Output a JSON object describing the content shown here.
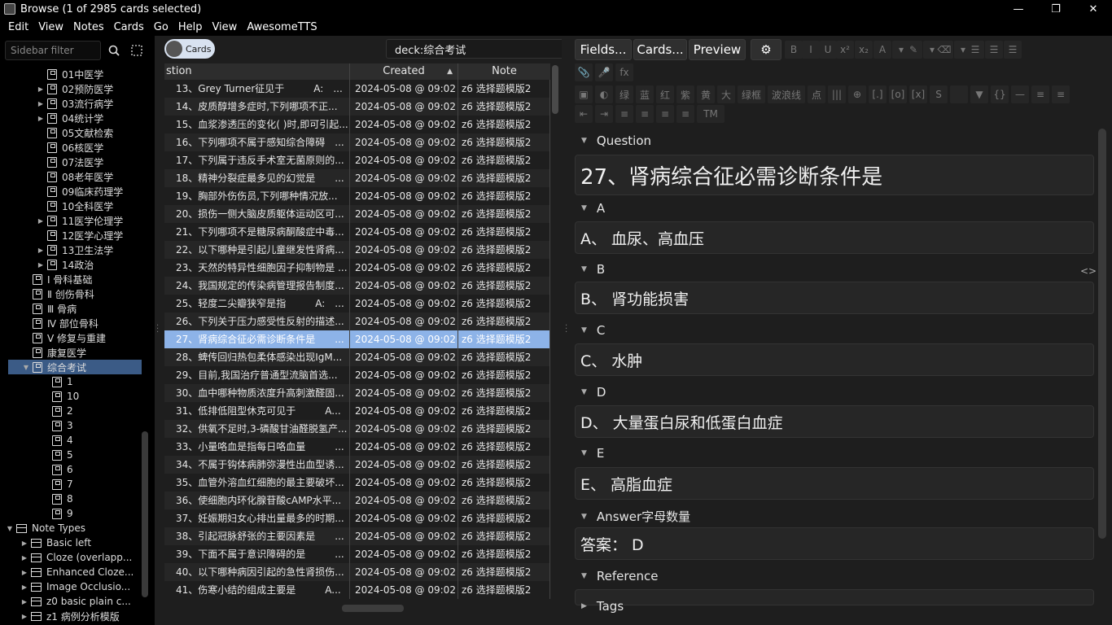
{
  "window": {
    "title": "Browse (1 of 2985 cards selected)",
    "minimize": "—",
    "restore": "❐",
    "close": "✕"
  },
  "menu": [
    "Edit",
    "View",
    "Notes",
    "Cards",
    "Go",
    "Help",
    "View",
    "AwesomeTTS"
  ],
  "sidebar": {
    "filter_placeholder": "Sidebar filter",
    "items": [
      {
        "label": "01中医学",
        "level": 3,
        "arrow": ""
      },
      {
        "label": "02预防医学",
        "level": 3,
        "arrow": "▶"
      },
      {
        "label": "03流行病学",
        "level": 3,
        "arrow": "▶"
      },
      {
        "label": "04统计学",
        "level": 3,
        "arrow": "▶"
      },
      {
        "label": "05文献检索",
        "level": 3,
        "arrow": ""
      },
      {
        "label": "06核医学",
        "level": 3,
        "arrow": ""
      },
      {
        "label": "07法医学",
        "level": 3,
        "arrow": ""
      },
      {
        "label": "08老年医学",
        "level": 3,
        "arrow": ""
      },
      {
        "label": "09临床药理学",
        "level": 3,
        "arrow": ""
      },
      {
        "label": "10全科医学",
        "level": 3,
        "arrow": ""
      },
      {
        "label": "11医学伦理学",
        "level": 3,
        "arrow": "▶"
      },
      {
        "label": "12医学心理学",
        "level": 3,
        "arrow": ""
      },
      {
        "label": "13卫生法学",
        "level": 3,
        "arrow": "▶"
      },
      {
        "label": "14政治",
        "level": 3,
        "arrow": "▶"
      },
      {
        "label": "Ⅰ 骨科基础",
        "level": 2,
        "arrow": ""
      },
      {
        "label": "Ⅱ 创伤骨科",
        "level": 2,
        "arrow": ""
      },
      {
        "label": "Ⅲ 骨病",
        "level": 2,
        "arrow": ""
      },
      {
        "label": "Ⅳ 部位骨科",
        "level": 2,
        "arrow": ""
      },
      {
        "label": "Ⅴ 修复与重建",
        "level": 2,
        "arrow": ""
      },
      {
        "label": "康复医学",
        "level": 2,
        "arrow": ""
      },
      {
        "label": "综合考试",
        "level": 2,
        "arrow": "▼",
        "selected": true
      },
      {
        "label": "1",
        "level": 3,
        "arrow": ""
      },
      {
        "label": "10",
        "level": 3,
        "arrow": ""
      },
      {
        "label": "2",
        "level": 3,
        "arrow": ""
      },
      {
        "label": "3",
        "level": 3,
        "arrow": ""
      },
      {
        "label": "4",
        "level": 3,
        "arrow": ""
      },
      {
        "label": "5",
        "level": 3,
        "arrow": ""
      },
      {
        "label": "6",
        "level": 3,
        "arrow": ""
      },
      {
        "label": "7",
        "level": 3,
        "arrow": ""
      },
      {
        "label": "8",
        "level": 3,
        "arrow": ""
      },
      {
        "label": "9",
        "level": 3,
        "arrow": ""
      },
      {
        "label": "Note Types",
        "level": 0,
        "arrow": "▼",
        "type": "nt"
      },
      {
        "label": "Basic left",
        "level": 1,
        "arrow": "▶",
        "type": "nt"
      },
      {
        "label": "Cloze (overlapp...",
        "level": 1,
        "arrow": "▶",
        "type": "nt"
      },
      {
        "label": "Enhanced Cloze...",
        "level": 1,
        "arrow": "▶",
        "type": "nt"
      },
      {
        "label": "Image Occlusio...",
        "level": 1,
        "arrow": "▶",
        "type": "nt"
      },
      {
        "label": "z0 basic plain c...",
        "level": 1,
        "arrow": "▶",
        "type": "nt"
      },
      {
        "label": "z1 病例分析模版",
        "level": 1,
        "arrow": "▶",
        "type": "nt"
      }
    ]
  },
  "cards": {
    "toggle_label": "Cards",
    "search_value": "deck:综合考试",
    "columns": [
      "stion",
      "Created",
      "Note"
    ],
    "sort_indicator": "▲",
    "rows": [
      {
        "q": "13、Grey Turner征见于　　　A:　...",
        "created": "2024-05-08 @ 09:02",
        "note": "z6 选择题模版2"
      },
      {
        "q": "14、皮质醇增多症时,下列哪项不正...",
        "created": "2024-05-08 @ 09:02",
        "note": "z6 选择题模版2"
      },
      {
        "q": "15、血浆渗透压的变化( )时,即可引起...",
        "created": "2024-05-08 @ 09:02",
        "note": "z6 选择题模版2"
      },
      {
        "q": "16、下列哪项不属于感知综合障碍　...",
        "created": "2024-05-08 @ 09:02",
        "note": "z6 选择题模版2"
      },
      {
        "q": "17、下列属于违反手术室无菌原则的...",
        "created": "2024-05-08 @ 09:02",
        "note": "z6 选择题模版2"
      },
      {
        "q": "18、精神分裂症最多见的幻觉是　　...",
        "created": "2024-05-08 @ 09:02",
        "note": "z6 选择题模版2"
      },
      {
        "q": "19、胸部外伤伤员,下列哪种情况放...",
        "created": "2024-05-08 @ 09:02",
        "note": "z6 选择题模版2"
      },
      {
        "q": "20、损伤一侧大脑皮质躯体运动区可...",
        "created": "2024-05-08 @ 09:02",
        "note": "z6 选择题模版2"
      },
      {
        "q": "21、下列哪项不是糖尿病酮酸症中毒...",
        "created": "2024-05-08 @ 09:02",
        "note": "z6 选择题模版2"
      },
      {
        "q": "22、以下哪种是引起儿童继发性肾病...",
        "created": "2024-05-08 @ 09:02",
        "note": "z6 选择题模版2"
      },
      {
        "q": "23、天然的特异性细胞因子抑制物是 ...",
        "created": "2024-05-08 @ 09:02",
        "note": "z6 选择题模版2"
      },
      {
        "q": "24、我国规定的传染病管理报告制度...",
        "created": "2024-05-08 @ 09:02",
        "note": "z6 选择题模版2"
      },
      {
        "q": "25、轻度二尖瓣狭窄是指　　　A:　...",
        "created": "2024-05-08 @ 09:02",
        "note": "z6 选择题模版2"
      },
      {
        "q": "26、下列关于压力感受性反射的描述...",
        "created": "2024-05-08 @ 09:02",
        "note": "z6 选择题模版2"
      },
      {
        "q": "27、肾病综合征必需诊断条件是　　...",
        "created": "2024-05-08 @ 09:02",
        "note": "z6 选择题模版2",
        "selected": true
      },
      {
        "q": "28、蜱传回归热包柔体感染出现IgM...",
        "created": "2024-05-08 @ 09:02",
        "note": "z6 选择题模版2"
      },
      {
        "q": "29、目前,我国治疗普通型流脑首选...",
        "created": "2024-05-08 @ 09:02",
        "note": "z6 选择题模版2"
      },
      {
        "q": "30、血中哪种物质浓度升高刺激醛固...",
        "created": "2024-05-08 @ 09:02",
        "note": "z6 选择题模版2"
      },
      {
        "q": "31、低排低阻型休克可见于　　　A...",
        "created": "2024-05-08 @ 09:02",
        "note": "z6 选择题模版2"
      },
      {
        "q": "32、供氧不足时,3-磷酸甘油醛脱氢产...",
        "created": "2024-05-08 @ 09:02",
        "note": "z6 选择题模版2"
      },
      {
        "q": "33、小量咯血是指每日咯血量　　　...",
        "created": "2024-05-08 @ 09:02",
        "note": "z6 选择题模版2"
      },
      {
        "q": "34、不属于钩体病肺弥漫性出血型诱...",
        "created": "2024-05-08 @ 09:02",
        "note": "z6 选择题模版2"
      },
      {
        "q": "35、血管外溶血红细胞的最主要破坏...",
        "created": "2024-05-08 @ 09:02",
        "note": "z6 选择题模版2"
      },
      {
        "q": "36、使细胞内环化腺苷酸cAMP水平...",
        "created": "2024-05-08 @ 09:02",
        "note": "z6 选择题模版2"
      },
      {
        "q": "37、妊娠期妇女心排出量最多的时期...",
        "created": "2024-05-08 @ 09:02",
        "note": "z6 选择题模版2"
      },
      {
        "q": "38、引起冠脉舒张的主要因素是　　...",
        "created": "2024-05-08 @ 09:02",
        "note": "z6 选择题模版2"
      },
      {
        "q": "39、下面不属于意识障碍的是　　　...",
        "created": "2024-05-08 @ 09:02",
        "note": "z6 选择题模版2"
      },
      {
        "q": "40、以下哪种病因引起的急性肾损伤...",
        "created": "2024-05-08 @ 09:02",
        "note": "z6 选择题模版2"
      },
      {
        "q": "41、伤寒小结的组成主要是　　　A...",
        "created": "2024-05-08 @ 09:02",
        "note": "z6 选择题模版2"
      }
    ]
  },
  "editor": {
    "buttons": [
      "Fields...",
      "Cards...",
      "Preview"
    ],
    "gear": "⚙",
    "row1_icons": [
      "B",
      "I",
      "U",
      "x²",
      "x₂",
      "A",
      "▾",
      "✎",
      "▾",
      "⌫",
      "▾",
      "☰",
      "☰",
      "☰"
    ],
    "row2_icons": [
      "📎",
      "🎤",
      "fx"
    ],
    "row3_icons": [
      "▣",
      "◐",
      "绿",
      "蓝",
      "红",
      "紫",
      "黄",
      "大",
      "绿框",
      "波浪线",
      "点",
      "|||",
      "⊕",
      "[.]",
      "[o]",
      "[x]",
      "S",
      " ",
      "▼",
      "{}",
      "—",
      "≡",
      "≡"
    ],
    "row4_icons": [
      "⇤",
      "⇥",
      "≡",
      "≡",
      "≡",
      "≡",
      "TM"
    ],
    "html_toggle": "<>",
    "fields": [
      {
        "label": "Question",
        "value": "27、肾病综合征必需诊断条件是",
        "size": 26
      },
      {
        "label": "A",
        "value": "A、 血尿、高血压",
        "size": 19
      },
      {
        "label": "B",
        "value": "B、 肾功能损害",
        "size": 19
      },
      {
        "label": "C",
        "value": "C、 水肿",
        "size": 19
      },
      {
        "label": "D",
        "value": "D、 大量蛋白尿和低蛋白血症",
        "size": 19
      },
      {
        "label": "E",
        "value": "E、 高脂血症",
        "size": 19
      },
      {
        "label": "Answer字母数量",
        "value": "答案： D",
        "size": 19
      },
      {
        "label": "Reference",
        "value": "",
        "size": 19
      }
    ],
    "tags_label": "Tags"
  }
}
